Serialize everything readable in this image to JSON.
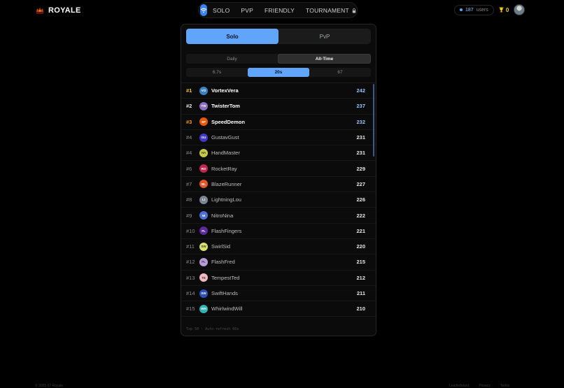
{
  "brand": {
    "name": "ROYALE"
  },
  "nav": {
    "modes": [
      "SOLO",
      "PVP",
      "FRIENDLY",
      "TOURNAMENT"
    ],
    "users_count": "187",
    "users_label": "users",
    "trophies": "0"
  },
  "leaderboard": {
    "type_tabs": [
      {
        "label": "Solo",
        "active": true
      },
      {
        "label": "PvP",
        "active": false
      }
    ],
    "period_tabs": [
      {
        "label": "Daily",
        "active": false
      },
      {
        "label": "All-Time",
        "active": true
      }
    ],
    "duration_tabs": [
      {
        "label": "6.7s",
        "active": false
      },
      {
        "label": "20s",
        "active": true
      },
      {
        "label": "67",
        "active": false
      }
    ],
    "rows": [
      {
        "rank": "#1",
        "initials": "VO",
        "name": "VortexVera",
        "score": "242",
        "avatar_color": "#3b82c4",
        "rank_color": "#facc15"
      },
      {
        "rank": "#2",
        "initials": "TW",
        "name": "TwisterTom",
        "score": "237",
        "avatar_color": "#8b6fc0",
        "rank_color": "#e5e7eb"
      },
      {
        "rank": "#3",
        "initials": "SP",
        "name": "SpeedDemon",
        "score": "232",
        "avatar_color": "#ea580c",
        "rank_color": "#f59e0b"
      },
      {
        "rank": "#4",
        "initials": "GU",
        "name": "GustavGust",
        "score": "231",
        "avatar_color": "#4338ca"
      },
      {
        "rank": "#4",
        "initials": "HA",
        "name": "HandMaster",
        "score": "231",
        "avatar_color": "#c5c947"
      },
      {
        "rank": "#6",
        "initials": "RO",
        "name": "RocketRay",
        "score": "229",
        "avatar_color": "#c0264f"
      },
      {
        "rank": "#7",
        "initials": "BL",
        "name": "BlazeRunner",
        "score": "227",
        "avatar_color": "#e2562a"
      },
      {
        "rank": "#8",
        "initials": "LI",
        "name": "LightningLou",
        "score": "226",
        "avatar_color": "#7a8696"
      },
      {
        "rank": "#9",
        "initials": "NI",
        "name": "NitroNina",
        "score": "222",
        "avatar_color": "#4f6fd8"
      },
      {
        "rank": "#10",
        "initials": "FL",
        "name": "FlashFingers",
        "score": "221",
        "avatar_color": "#5b2a9c"
      },
      {
        "rank": "#11",
        "initials": "SW",
        "name": "SwirlSid",
        "score": "220",
        "avatar_color": "#d9e06b"
      },
      {
        "rank": "#12",
        "initials": "FL",
        "name": "FlashFred",
        "score": "215",
        "avatar_color": "#b79ad8"
      },
      {
        "rank": "#13",
        "initials": "TE",
        "name": "TempestTed",
        "score": "212",
        "avatar_color": "#f2b8c4"
      },
      {
        "rank": "#14",
        "initials": "SW",
        "name": "SwiftHands",
        "score": "211",
        "avatar_color": "#2f50b8"
      },
      {
        "rank": "#15",
        "initials": "WH",
        "name": "WhirlwindWill",
        "score": "210",
        "avatar_color": "#2fb3b3"
      },
      {
        "rank": "#16",
        "initials": "",
        "name": "",
        "score": "",
        "avatar_color": "#2fb37a"
      }
    ],
    "footer_note": "Top 50 · Auto-refresh 60s"
  },
  "footer": {
    "copyright": "© 2025 67 Royale",
    "links": [
      "Leaderboard",
      "Privacy",
      "Terms"
    ]
  }
}
